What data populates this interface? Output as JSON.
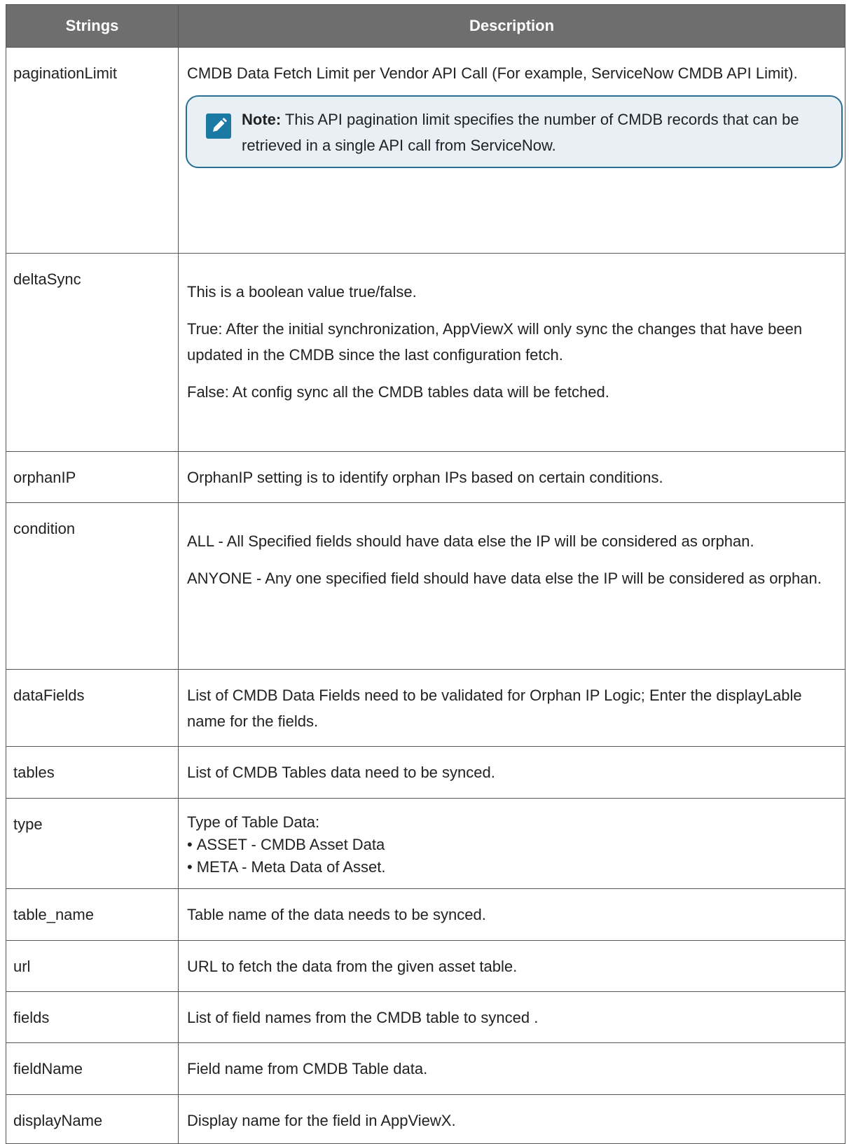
{
  "header": {
    "col1": "Strings",
    "col2": "Description"
  },
  "rows": {
    "paginationLimit": {
      "key": "paginationLimit",
      "desc": "CMDB Data Fetch Limit per Vendor API Call (For example, ServiceNow CMDB API Limit).",
      "note_label": "Note:",
      "note_text": " This API pagination limit specifies the number of CMDB records that can be retrieved in a single API call from ServiceNow."
    },
    "deltaSync": {
      "key": "deltaSync",
      "p1": "This is a boolean value true/false.",
      "p2": "True: After the initial synchronization, AppViewX will only sync the changes that have been updated in the CMDB since the last configuration fetch.",
      "p3": "False: At config sync all the CMDB tables data will be fetched."
    },
    "orphanIP": {
      "key": "orphanIP",
      "desc": "OrphanIP setting is to identify orphan IPs based on certain conditions."
    },
    "condition": {
      "key": "condition",
      "p1": "ALL - All Specified fields should have data else the IP will be considered as orphan.",
      "p2": "ANYONE - Any one specified field should have data else the IP will be considered as orphan."
    },
    "dataFields": {
      "key": "dataFields",
      "desc": "List of CMDB Data Fields need to be validated for Orphan IP Logic; Enter the displayLable name for the fields."
    },
    "tables": {
      "key": "tables",
      "desc": "List of CMDB Tables data need to be synced."
    },
    "type": {
      "key": "type",
      "intro": "Type of Table Data:",
      "bullets": [
        "ASSET - CMDB Asset Data",
        "META - Meta Data of Asset."
      ]
    },
    "table_name": {
      "key": "table_name",
      "desc": "Table name of the data needs to be synced."
    },
    "url": {
      "key": "url",
      "desc": "URL to fetch the data from the given asset table."
    },
    "fields": {
      "key": "fields",
      "desc": "List of field names from the CMDB table to synced ."
    },
    "fieldName": {
      "key": "fieldName",
      "desc": "Field name from CMDB Table data."
    },
    "displayName": {
      "key": "displayName",
      "desc": "Display name for the field in AppViewX."
    }
  },
  "colors": {
    "header_bg": "#6e6e6e",
    "note_border": "#2a6e92",
    "note_bg": "#e8f0f5",
    "note_icon": "#1b7aa3"
  },
  "icons": {
    "note": "pencil-note-icon"
  }
}
